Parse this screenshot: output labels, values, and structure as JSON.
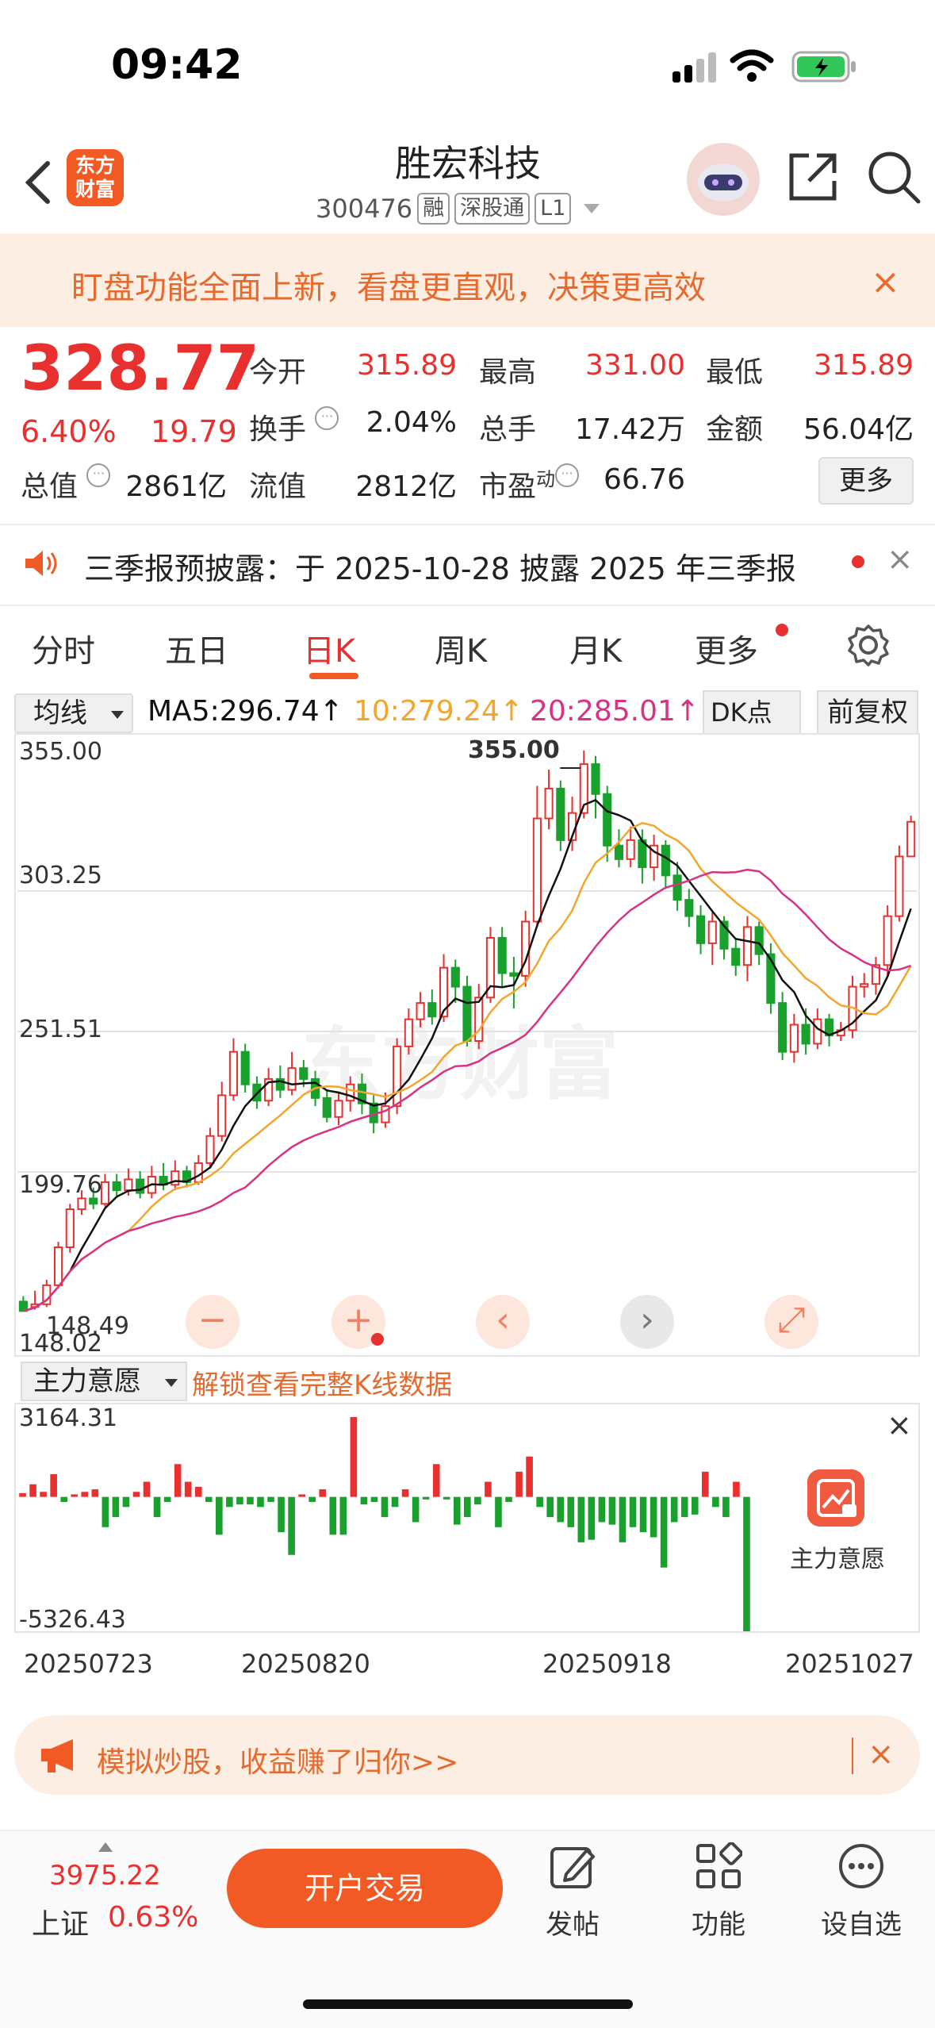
{
  "status_bar": {
    "time": "09:42"
  },
  "header": {
    "logo_line1": "东方",
    "logo_line2": "财富",
    "stock_name": "胜宏科技",
    "stock_code": "300476",
    "tags": [
      "融",
      "深股通",
      "L1"
    ]
  },
  "banner": {
    "text": "盯盘功能全面上新，看盘更直观，决策更高效",
    "close": "×"
  },
  "quote": {
    "price": "328.77",
    "change_pct": "6.40%",
    "change_amt": "19.79",
    "open_label": "今开",
    "open": "315.89",
    "high_label": "最高",
    "high": "331.00",
    "low_label": "最低",
    "low": "315.89",
    "turnover_label": "换手",
    "turnover": "2.04%",
    "volume_label": "总手",
    "volume": "17.42万",
    "amount_label": "金额",
    "amount": "56.04亿",
    "mktcap_label": "总值",
    "mktcap": "2861亿",
    "float_label": "流值",
    "float": "2812亿",
    "pe_label": "市盈",
    "pe_sup": "动",
    "pe": "66.76",
    "more": "更多"
  },
  "notice": {
    "text": "三季报预披露：于 2025-10-28 披露 2025 年三季报",
    "close": "×"
  },
  "tabs": [
    "分时",
    "五日",
    "日K",
    "周K",
    "月K",
    "更多"
  ],
  "ma_row": {
    "select": "均线",
    "ma5": "MA5:296.74↑",
    "ma10": "10:279.24↑",
    "ma20": "20:285.01↑",
    "dk": "DK点",
    "adjust": "前复权"
  },
  "colors": {
    "up": "#e8302f",
    "down": "#19a02d",
    "ma5": "#111111",
    "ma10": "#f3a62e",
    "ma20": "#d63384",
    "accent": "#f15a24"
  },
  "chart_data": [
    {
      "type": "candlestick",
      "yticks": [
        "355.00",
        "303.25",
        "251.51",
        "199.76",
        "148.02"
      ],
      "ylim": [
        148.02,
        355.0
      ],
      "max_label": "355.00",
      "min_label": "148.49",
      "candles": [
        [
          152,
          148.5,
          154,
          150
        ],
        [
          150,
          151,
          156,
          149
        ],
        [
          151,
          158,
          160,
          150
        ],
        [
          158,
          172,
          174,
          157
        ],
        [
          172,
          186,
          188,
          170
        ],
        [
          186,
          190,
          193,
          184
        ],
        [
          190,
          188,
          194,
          186
        ],
        [
          188,
          196,
          199,
          187
        ],
        [
          196,
          193,
          199,
          191
        ],
        [
          193,
          197,
          201,
          191
        ],
        [
          197,
          192,
          200,
          190
        ],
        [
          192,
          198,
          202,
          190
        ],
        [
          198,
          195,
          203,
          193
        ],
        [
          195,
          200,
          204,
          193
        ],
        [
          200,
          196,
          202,
          194
        ],
        [
          196,
          203,
          206,
          195
        ],
        [
          203,
          213,
          216,
          201
        ],
        [
          213,
          228,
          233,
          211
        ],
        [
          228,
          244,
          249,
          226
        ],
        [
          244,
          232,
          247,
          229
        ],
        [
          232,
          226,
          235,
          223
        ],
        [
          226,
          234,
          238,
          224
        ],
        [
          234,
          230,
          239,
          227
        ],
        [
          230,
          238,
          244,
          228
        ],
        [
          238,
          234,
          241,
          231
        ],
        [
          234,
          227,
          237,
          224
        ],
        [
          227,
          220,
          230,
          218
        ],
        [
          220,
          226,
          229,
          217
        ],
        [
          226,
          232,
          235,
          222
        ],
        [
          232,
          225,
          236,
          221
        ],
        [
          225,
          218,
          228,
          214
        ],
        [
          218,
          224,
          229,
          216
        ],
        [
          224,
          246,
          249,
          221
        ],
        [
          246,
          256,
          260,
          243
        ],
        [
          256,
          262,
          266,
          253
        ],
        [
          262,
          257,
          267,
          254
        ],
        [
          257,
          275,
          280,
          255
        ],
        [
          275,
          268,
          278,
          262
        ],
        [
          268,
          248,
          272,
          246
        ],
        [
          248,
          264,
          269,
          245
        ],
        [
          264,
          286,
          290,
          262
        ],
        [
          286,
          273,
          290,
          268
        ],
        [
          273,
          272,
          279,
          260
        ],
        [
          272,
          292,
          296,
          268
        ],
        [
          292,
          330,
          342,
          290
        ],
        [
          330,
          341,
          348,
          326
        ],
        [
          341,
          322,
          344,
          318
        ],
        [
          322,
          332,
          338,
          318
        ],
        [
          332,
          350,
          355,
          330
        ],
        [
          350,
          339,
          353,
          330
        ],
        [
          339,
          320,
          342,
          314
        ],
        [
          320,
          315,
          326,
          312
        ],
        [
          315,
          322,
          327,
          312
        ],
        [
          322,
          312,
          326,
          306
        ],
        [
          312,
          320,
          324,
          307
        ],
        [
          320,
          309,
          322,
          304
        ],
        [
          309,
          300,
          314,
          296
        ],
        [
          300,
          294,
          304,
          290
        ],
        [
          294,
          284,
          298,
          280
        ],
        [
          284,
          292,
          296,
          276
        ],
        [
          292,
          282,
          294,
          278
        ],
        [
          282,
          276,
          286,
          272
        ],
        [
          276,
          290,
          294,
          270
        ],
        [
          290,
          280,
          292,
          276
        ],
        [
          280,
          262,
          284,
          258
        ],
        [
          262,
          244,
          266,
          241
        ],
        [
          244,
          254,
          258,
          240
        ],
        [
          254,
          247,
          260,
          243
        ],
        [
          247,
          256,
          260,
          245
        ],
        [
          256,
          250,
          258,
          246
        ],
        [
          250,
          252,
          255,
          248
        ],
        [
          252,
          268,
          272,
          249
        ],
        [
          268,
          269,
          273,
          264
        ],
        [
          269,
          276,
          279,
          265
        ],
        [
          276,
          294,
          298,
          272
        ],
        [
          294,
          316,
          320,
          292
        ],
        [
          316,
          328.77,
          331,
          315.89
        ]
      ]
    },
    {
      "type": "bar",
      "title": "主力意愿",
      "yticks": [
        "3164.31",
        "-5326.43"
      ],
      "ylim": [
        -5326.43,
        3164.31
      ],
      "x": [
        "20250723",
        "20250820",
        "20250918",
        "20251027"
      ],
      "values": [
        150,
        500,
        200,
        900,
        -200,
        100,
        200,
        300,
        -1200,
        -800,
        -400,
        200,
        600,
        -800,
        -200,
        1300,
        600,
        400,
        -200,
        -1500,
        -400,
        -300,
        -300,
        -400,
        -200,
        -1400,
        -2300,
        100,
        -200,
        300,
        -1500,
        -1500,
        3164.31,
        -300,
        -200,
        -800,
        -400,
        300,
        -1000,
        -100,
        1300,
        -100,
        -1100,
        -800,
        -300,
        600,
        -1200,
        -200,
        1000,
        1600,
        -400,
        -800,
        -1000,
        -1200,
        -1800,
        -1700,
        -1000,
        -1100,
        -1800,
        -1200,
        -1400,
        -1600,
        -2800,
        -1000,
        -800,
        -700,
        1000,
        -400,
        -800,
        600,
        -5326.43
      ]
    }
  ],
  "chart_controls": {
    "zoom_out": "−",
    "zoom_in": "+",
    "prev": "‹",
    "next": "›",
    "expand": "⤢"
  },
  "indicator": {
    "select": "主力意愿",
    "unlock": "解锁查看完整K线数据",
    "badge_label": "主力意愿",
    "close": "×"
  },
  "promo": {
    "text": "模拟炒股，收益赚了归你>>",
    "close": "×"
  },
  "bottom": {
    "index_value": "3975.22",
    "index_name": "上证",
    "index_pct": "0.63%",
    "trade": "开户交易",
    "nav": [
      "发帖",
      "功能",
      "设自选"
    ]
  }
}
